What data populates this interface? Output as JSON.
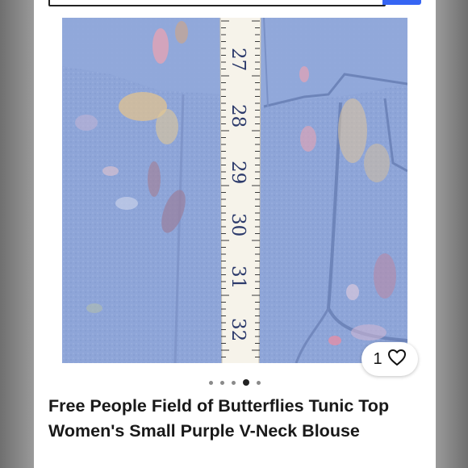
{
  "listing": {
    "title": "Free People Field of Butterflies Tunic Top Women's Small Purple V-Neck Blouse",
    "likes": "1",
    "photo_count": 5,
    "active_photo_index": 3
  },
  "tape_measure": {
    "numbers": [
      "27",
      "28",
      "29",
      "30",
      "31",
      "32"
    ]
  },
  "colors": {
    "accent": "#3665f3",
    "fabric": "#8fa6d6",
    "title_text": "#191919"
  },
  "icons": {
    "like": "heart-outline-icon"
  }
}
